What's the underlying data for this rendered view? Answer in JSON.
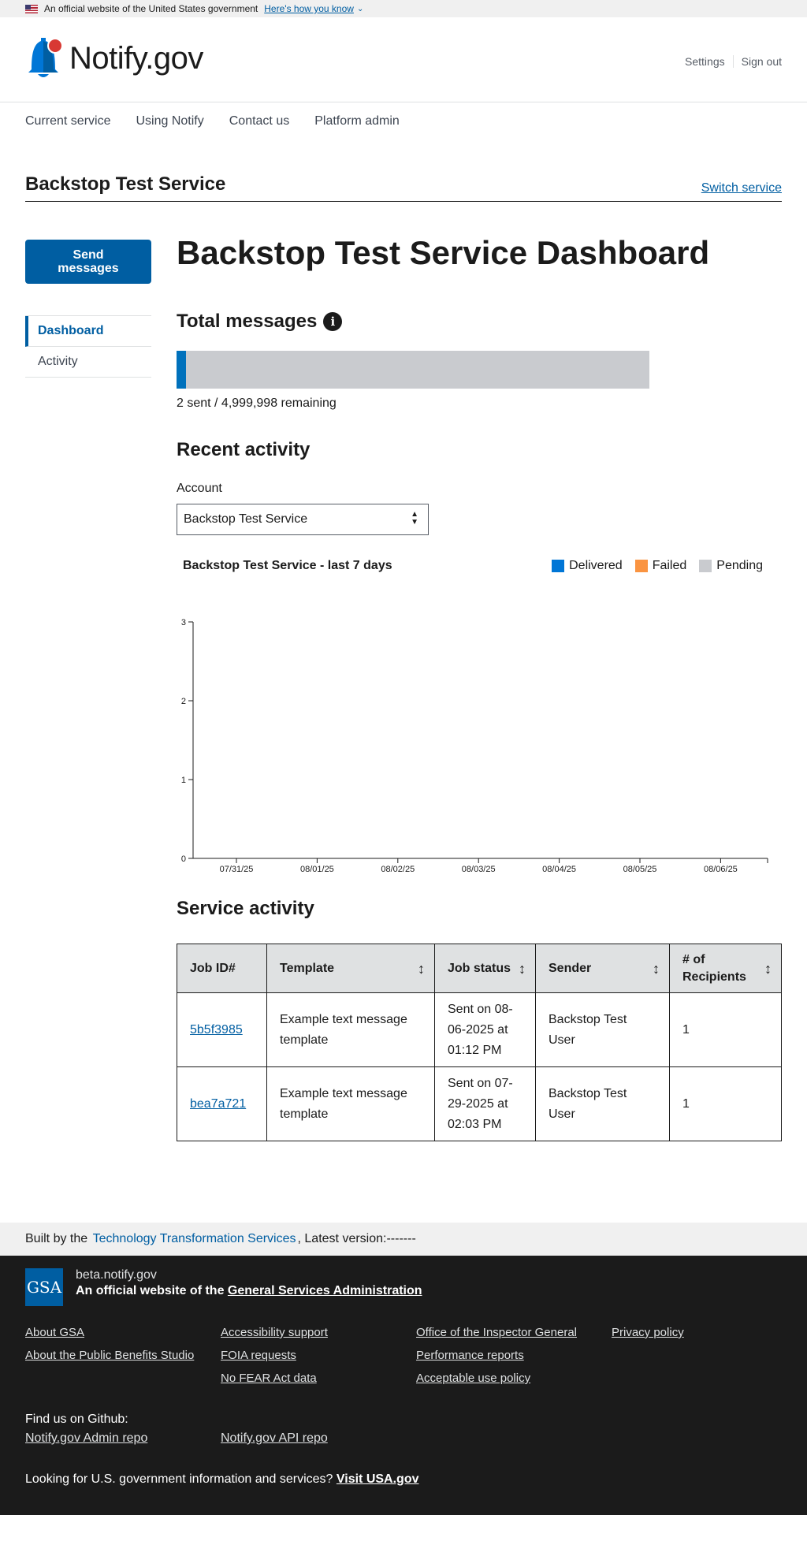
{
  "gov_banner": {
    "text": "An official website of the United States government",
    "how_link": "Here's how you know"
  },
  "header": {
    "logo_text": "Notify.gov",
    "settings": "Settings",
    "sign_out": "Sign out"
  },
  "nav": {
    "items": [
      "Current service",
      "Using Notify",
      "Contact us",
      "Platform admin"
    ]
  },
  "service_bar": {
    "name": "Backstop Test Service",
    "switch": "Switch service"
  },
  "sidebar": {
    "send_button": "Send messages",
    "items": [
      {
        "label": "Dashboard",
        "active": true
      },
      {
        "label": "Activity",
        "active": false
      }
    ]
  },
  "main": {
    "title": "Backstop Test Service Dashboard",
    "total_heading": "Total messages",
    "info_icon": "info-icon",
    "meter": {
      "sent": 2,
      "total": 5000000,
      "fraction": 4e-07
    },
    "meter_text": "2 sent / 4,999,998 remaining",
    "recent_heading": "Recent activity",
    "account_label": "Account",
    "account_value": "Backstop Test Service",
    "service_heading": "Service activity"
  },
  "chart_data": {
    "type": "bar",
    "title": "Backstop Test Service - last 7 days",
    "categories": [
      "07/31/25",
      "08/01/25",
      "08/02/25",
      "08/03/25",
      "08/04/25",
      "08/05/25",
      "08/06/25"
    ],
    "series": [
      {
        "name": "Delivered",
        "color": "#0076d6",
        "values": [
          0,
          0,
          0,
          0,
          0,
          0,
          0
        ]
      },
      {
        "name": "Failed",
        "color": "#fa9441",
        "values": [
          0,
          0,
          0,
          0,
          0,
          0,
          0
        ]
      },
      {
        "name": "Pending",
        "color": "#c9cbcf",
        "values": [
          0,
          0,
          0,
          0,
          0,
          0,
          0
        ]
      }
    ],
    "yticks": [
      0,
      1,
      2,
      3
    ],
    "ylim": [
      0,
      3
    ],
    "legend": "top-right",
    "grid": false
  },
  "table": {
    "headers": [
      "Job ID#",
      "Template",
      "Job status",
      "Sender",
      "# of Recipients"
    ],
    "rows": [
      {
        "job_id": "5b5f3985",
        "template": "Example text message template",
        "status": "Sent on 08-06-2025 at 01:12 PM",
        "sender": "Backstop Test User",
        "recipients": "1"
      },
      {
        "job_id": "bea7a721",
        "template": "Example text message template",
        "status": "Sent on 07-29-2025 at 02:03 PM",
        "sender": "Backstop Test User",
        "recipients": "1"
      }
    ]
  },
  "version_bar": {
    "prefix": "Built by the",
    "link": "Technology Transformation Services",
    "suffix": ", Latest version:",
    "version": "-------"
  },
  "footer": {
    "logo": "GSA",
    "domain": "beta.notify.gov",
    "official_prefix": "An official website of the",
    "official_link": "General Services Administration",
    "link_columns": [
      [
        "About GSA",
        "About the Public Benefits Studio"
      ],
      [
        "Accessibility support",
        "FOIA requests",
        "No FEAR Act data"
      ],
      [
        "Office of the Inspector General",
        "Performance reports",
        "Acceptable use policy"
      ],
      [
        "Privacy policy"
      ]
    ],
    "github_heading": "Find us on Github:",
    "github_links": [
      "Notify.gov Admin repo",
      "Notify.gov API repo"
    ],
    "usa_prefix": "Looking for U.S. government information and services?",
    "usa_link": "Visit USA.gov"
  }
}
